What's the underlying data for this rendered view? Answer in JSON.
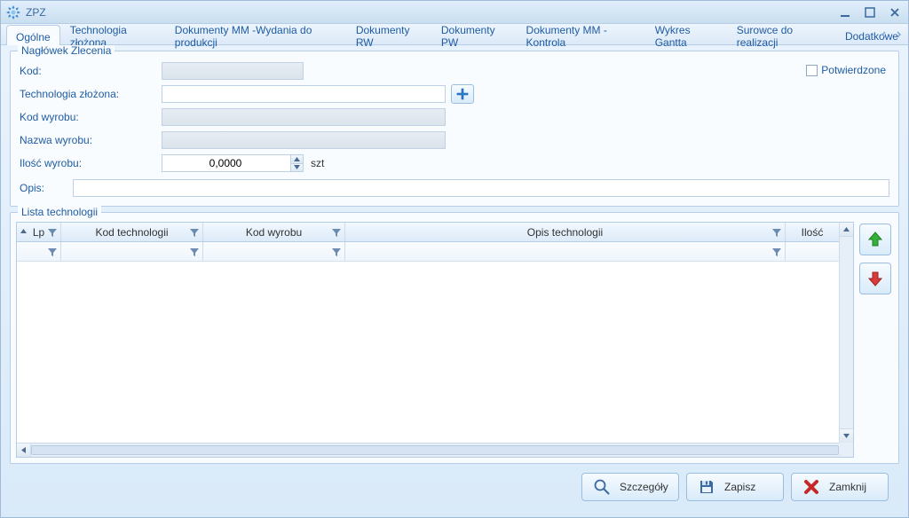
{
  "window": {
    "title": "ZPZ"
  },
  "tabs": [
    {
      "label": "Ogólne",
      "active": true
    },
    {
      "label": "Technologia złożona"
    },
    {
      "label": "Dokumenty MM -Wydania do produkcji"
    },
    {
      "label": "Dokumenty RW"
    },
    {
      "label": "Dokumenty PW"
    },
    {
      "label": "Dokumenty MM - Kontrola"
    },
    {
      "label": "Wykres Gantta"
    },
    {
      "label": "Surowce do realizacji"
    },
    {
      "label": "Dodatkowe"
    }
  ],
  "header_group": {
    "legend": "Nagłówek Zlecenia",
    "kod_label": "Kod:",
    "kod_value": "",
    "techz_label": "Technologia złożona:",
    "techz_value": "",
    "kodw_label": "Kod wyrobu:",
    "kodw_value": "",
    "nazw_label": "Nazwa wyrobu:",
    "nazw_value": "",
    "ilosc_label": "Ilość wyrobu:",
    "ilosc_value": "0,0000",
    "ilosc_unit": "szt",
    "opis_label": "Opis:",
    "opis_value": "",
    "confirmed_label": "Potwierdzone",
    "confirmed_checked": false
  },
  "list_group": {
    "legend": "Lista technologii",
    "columns": {
      "lp": "Lp",
      "kt": "Kod technologii",
      "kw": "Kod wyrobu",
      "ot": "Opis technologii",
      "il": "Ilość"
    }
  },
  "footer": {
    "details": "Szczegóły",
    "save": "Zapisz",
    "close": "Zamknij"
  }
}
